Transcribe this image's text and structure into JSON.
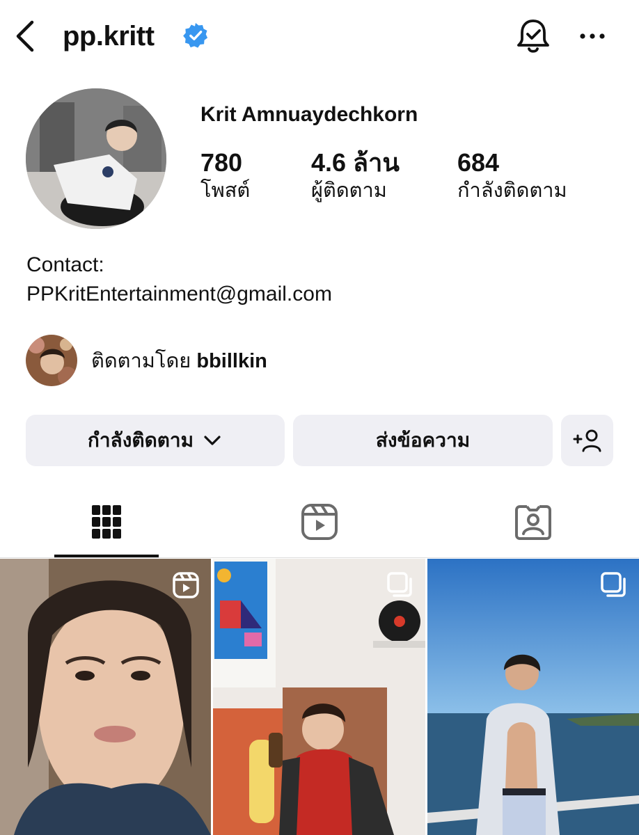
{
  "header": {
    "username": "pp.kritt",
    "icons": {
      "back": "chevron-left-icon",
      "verified": "verified-badge-icon",
      "notifications": "bell-check-icon",
      "more": "more-horizontal-icon"
    }
  },
  "profile": {
    "full_name": "Krit Amnuaydechkorn",
    "stats": [
      {
        "value": "780",
        "label": "โพสต์"
      },
      {
        "value": "4.6 ล้าน",
        "label": "ผู้ติดตาม"
      },
      {
        "value": "684",
        "label": "กำลังติดตาม"
      }
    ],
    "bio": {
      "line1": "Contact:",
      "line2": "PPKritEntertainment@gmail.com"
    },
    "followed_by": {
      "prefix": "ติดตามโดย",
      "username": "bbillkin"
    }
  },
  "actions": {
    "following_label": "กำลังติดตาม",
    "message_label": "ส่งข้อความ",
    "icons": {
      "following_chevron": "chevron-down-icon",
      "suggested": "add-person-icon"
    }
  },
  "tabs": [
    {
      "icon": "grid-icon",
      "active": true
    },
    {
      "icon": "reels-icon",
      "active": false
    },
    {
      "icon": "tagged-icon",
      "active": false
    }
  ],
  "posts": [
    {
      "badge": "reel-icon"
    },
    {
      "badge": "carousel-icon"
    },
    {
      "badge": "carousel-icon"
    }
  ],
  "colors": {
    "verified": "#3897f0",
    "button_bg": "#efeff4",
    "text": "#111111"
  }
}
